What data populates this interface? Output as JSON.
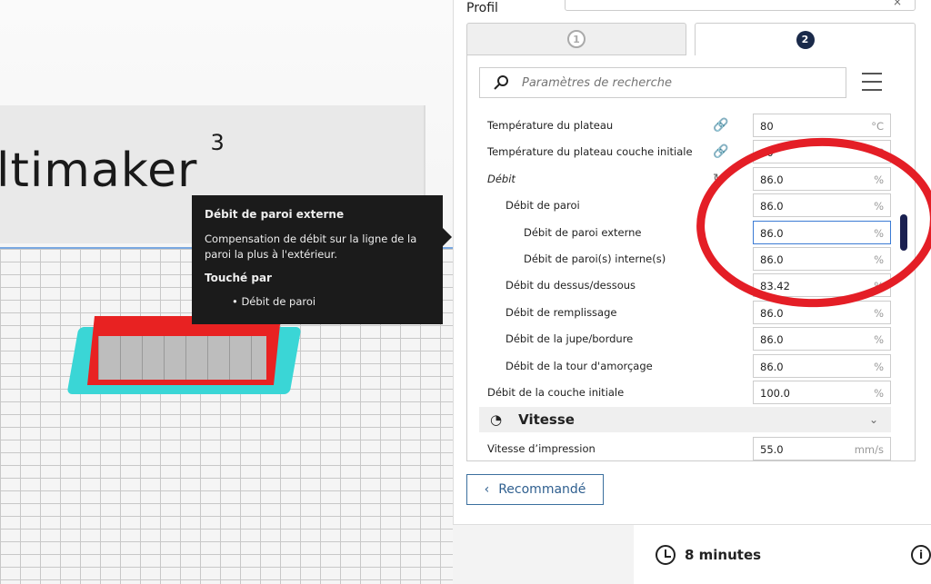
{
  "viewport": {
    "logo_text": "ltimaker",
    "logo_sup": "3"
  },
  "tooltip": {
    "title": "Débit de paroi externe",
    "description": "Compensation de débit sur la ligne de la paroi la plus à l'extérieur.",
    "affected_by_label": "Touché par",
    "affected_by": [
      "• Débit de paroi"
    ]
  },
  "panel": {
    "profile_label": "Profil",
    "profile_clear": "×",
    "tabs": [
      {
        "label": "1"
      },
      {
        "label": "2"
      }
    ],
    "search_placeholder": "Paramètres de recherche",
    "settings": [
      {
        "label": "Température du plateau",
        "value": "80",
        "unit": "°C",
        "icon": "link-icon"
      },
      {
        "label": "Température du plateau couche initiale",
        "value": "60",
        "unit": "°C",
        "icon": "link-icon"
      },
      {
        "label": "Débit",
        "value": "86.0",
        "unit": "%",
        "icon": "reset-icon"
      },
      {
        "label": "Débit de paroi",
        "value": "86.0",
        "unit": "%"
      },
      {
        "label": "Débit de paroi externe",
        "value": "86.0",
        "unit": "%"
      },
      {
        "label": "Débit de paroi(s) interne(s)",
        "value": "86.0",
        "unit": "%"
      },
      {
        "label": "Débit du dessus/dessous",
        "value": "83.42",
        "unit": "%"
      },
      {
        "label": "Débit de remplissage",
        "value": "86.0",
        "unit": "%"
      },
      {
        "label": "Débit de la jupe/bordure",
        "value": "86.0",
        "unit": "%"
      },
      {
        "label": "Débit de la tour d'amorçage",
        "value": "86.0",
        "unit": "%"
      },
      {
        "label": "Débit de la couche initiale",
        "value": "100.0",
        "unit": "%"
      }
    ],
    "section": {
      "label": "Vitesse"
    },
    "speed": {
      "label": "Vitesse d’impression",
      "value": "55.0",
      "unit": "mm/s"
    },
    "recommended_button": "Recommandé"
  },
  "info": {
    "print_time": "8 minutes"
  }
}
